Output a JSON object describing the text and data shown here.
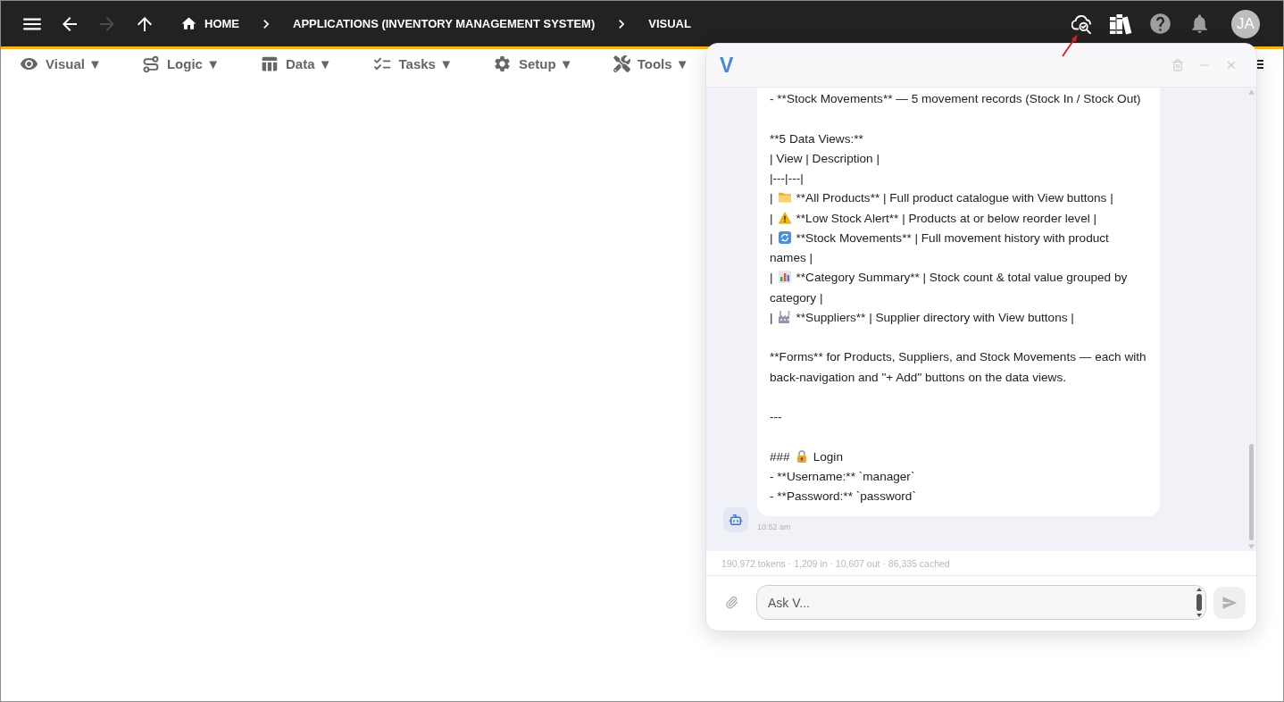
{
  "top_bar": {
    "nav": [
      {
        "kind": "back",
        "disabled": false
      },
      {
        "kind": "forward",
        "disabled": true
      },
      {
        "kind": "up",
        "disabled": false
      }
    ],
    "breadcrumbs": [
      {
        "kind": "home",
        "label": "HOME"
      },
      {
        "kind": "page",
        "label": "APPLICATIONS (INVENTORY MANAGEMENT SYSTEM)"
      },
      {
        "kind": "page",
        "label": "VISUAL"
      }
    ],
    "avatar": {
      "initials": "JA"
    }
  },
  "toolbar": {
    "menus": [
      {
        "kind": "eye",
        "label": "Visual",
        "caret": "▼"
      },
      {
        "kind": "logic",
        "label": "Logic",
        "caret": "▼"
      },
      {
        "kind": "data",
        "label": "Data",
        "caret": "▼"
      },
      {
        "kind": "tasks",
        "label": "Tasks",
        "caret": "▼"
      },
      {
        "kind": "setup",
        "label": "Setup",
        "caret": "▼"
      },
      {
        "kind": "tools",
        "label": "Tools",
        "caret": "▼"
      }
    ]
  },
  "chat": {
    "logo": "V",
    "message": {
      "lines": [
        {
          "kind": "text",
          "text": "- **Stock Movements** — 5 movement records (Stock In / Stock Out)"
        },
        {
          "kind": "blank"
        },
        {
          "kind": "text",
          "text": "**5 Data Views:**"
        },
        {
          "kind": "text",
          "text": "| View | Description |"
        },
        {
          "kind": "text",
          "text": "|---|---|"
        },
        {
          "kind": "folder",
          "lead": "|",
          "text": "**All Products** | Full product catalogue with View buttons |"
        },
        {
          "kind": "warning",
          "lead": "|",
          "text": "**Low Stock Alert** | Products at or below reorder level |"
        },
        {
          "kind": "refresh",
          "lead": "|",
          "text": "**Stock Movements** | Full movement history with product",
          "continued": "names |"
        },
        {
          "kind": "chart",
          "lead": "|",
          "text": "**Category Summary** | Stock count & total value grouped by",
          "continued": "category |"
        },
        {
          "kind": "factory",
          "lead": "|",
          "text": "**Suppliers** | Supplier directory with View buttons |"
        },
        {
          "kind": "blank"
        },
        {
          "kind": "text",
          "text": "**Forms** for Products, Suppliers, and Stock Movements — each with back-navigation and \"+ Add\" buttons on the data views."
        },
        {
          "kind": "blank"
        },
        {
          "kind": "text",
          "text": "---"
        },
        {
          "kind": "blank"
        },
        {
          "kind": "lock",
          "lead": "###",
          "text": "Login"
        },
        {
          "kind": "text",
          "text": "- **Username:** `manager`"
        },
        {
          "kind": "text",
          "text": "- **Password:** `password`"
        }
      ],
      "time": "10:52 am"
    },
    "usage": "190,972 tokens · 1,209 in · 10,607 out · 86,335 cached",
    "input": {
      "placeholder": "Ask V..."
    }
  }
}
